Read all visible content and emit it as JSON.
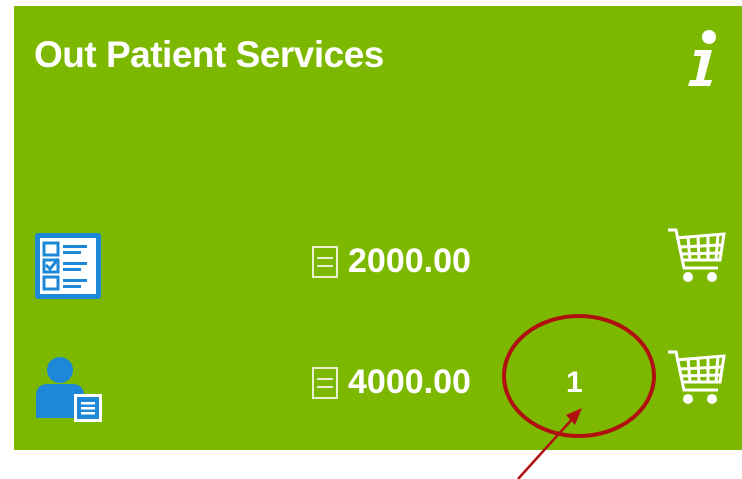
{
  "panel": {
    "title": "Out Patient Services",
    "accent": "#7db800"
  },
  "rows": [
    {
      "icon": "checklist-icon",
      "price": "2000.00",
      "qty": ""
    },
    {
      "icon": "patient-record-icon",
      "price": "4000.00",
      "qty": "1"
    }
  ],
  "annotation": {
    "color": "#b01010"
  }
}
